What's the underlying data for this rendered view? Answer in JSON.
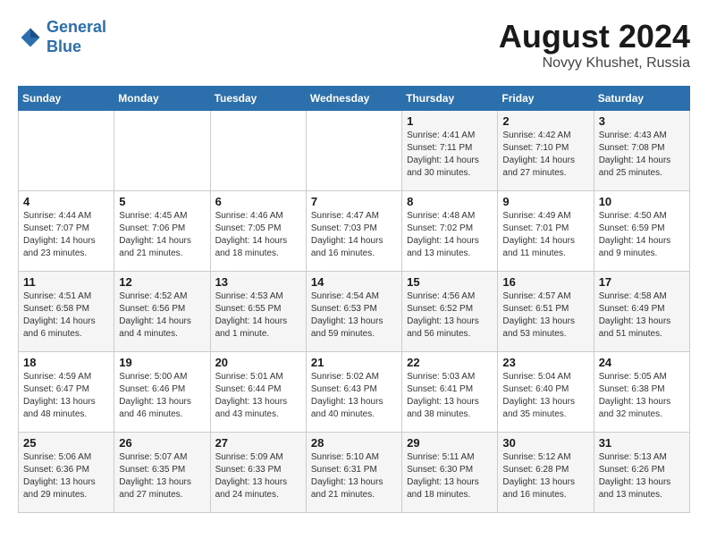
{
  "header": {
    "logo_line1": "General",
    "logo_line2": "Blue",
    "month_year": "August 2024",
    "location": "Novyy Khushet, Russia"
  },
  "weekdays": [
    "Sunday",
    "Monday",
    "Tuesday",
    "Wednesday",
    "Thursday",
    "Friday",
    "Saturday"
  ],
  "weeks": [
    [
      {
        "day": "",
        "info": ""
      },
      {
        "day": "",
        "info": ""
      },
      {
        "day": "",
        "info": ""
      },
      {
        "day": "",
        "info": ""
      },
      {
        "day": "1",
        "info": "Sunrise: 4:41 AM\nSunset: 7:11 PM\nDaylight: 14 hours\nand 30 minutes."
      },
      {
        "day": "2",
        "info": "Sunrise: 4:42 AM\nSunset: 7:10 PM\nDaylight: 14 hours\nand 27 minutes."
      },
      {
        "day": "3",
        "info": "Sunrise: 4:43 AM\nSunset: 7:08 PM\nDaylight: 14 hours\nand 25 minutes."
      }
    ],
    [
      {
        "day": "4",
        "info": "Sunrise: 4:44 AM\nSunset: 7:07 PM\nDaylight: 14 hours\nand 23 minutes."
      },
      {
        "day": "5",
        "info": "Sunrise: 4:45 AM\nSunset: 7:06 PM\nDaylight: 14 hours\nand 21 minutes."
      },
      {
        "day": "6",
        "info": "Sunrise: 4:46 AM\nSunset: 7:05 PM\nDaylight: 14 hours\nand 18 minutes."
      },
      {
        "day": "7",
        "info": "Sunrise: 4:47 AM\nSunset: 7:03 PM\nDaylight: 14 hours\nand 16 minutes."
      },
      {
        "day": "8",
        "info": "Sunrise: 4:48 AM\nSunset: 7:02 PM\nDaylight: 14 hours\nand 13 minutes."
      },
      {
        "day": "9",
        "info": "Sunrise: 4:49 AM\nSunset: 7:01 PM\nDaylight: 14 hours\nand 11 minutes."
      },
      {
        "day": "10",
        "info": "Sunrise: 4:50 AM\nSunset: 6:59 PM\nDaylight: 14 hours\nand 9 minutes."
      }
    ],
    [
      {
        "day": "11",
        "info": "Sunrise: 4:51 AM\nSunset: 6:58 PM\nDaylight: 14 hours\nand 6 minutes."
      },
      {
        "day": "12",
        "info": "Sunrise: 4:52 AM\nSunset: 6:56 PM\nDaylight: 14 hours\nand 4 minutes."
      },
      {
        "day": "13",
        "info": "Sunrise: 4:53 AM\nSunset: 6:55 PM\nDaylight: 14 hours\nand 1 minute."
      },
      {
        "day": "14",
        "info": "Sunrise: 4:54 AM\nSunset: 6:53 PM\nDaylight: 13 hours\nand 59 minutes."
      },
      {
        "day": "15",
        "info": "Sunrise: 4:56 AM\nSunset: 6:52 PM\nDaylight: 13 hours\nand 56 minutes."
      },
      {
        "day": "16",
        "info": "Sunrise: 4:57 AM\nSunset: 6:51 PM\nDaylight: 13 hours\nand 53 minutes."
      },
      {
        "day": "17",
        "info": "Sunrise: 4:58 AM\nSunset: 6:49 PM\nDaylight: 13 hours\nand 51 minutes."
      }
    ],
    [
      {
        "day": "18",
        "info": "Sunrise: 4:59 AM\nSunset: 6:47 PM\nDaylight: 13 hours\nand 48 minutes."
      },
      {
        "day": "19",
        "info": "Sunrise: 5:00 AM\nSunset: 6:46 PM\nDaylight: 13 hours\nand 46 minutes."
      },
      {
        "day": "20",
        "info": "Sunrise: 5:01 AM\nSunset: 6:44 PM\nDaylight: 13 hours\nand 43 minutes."
      },
      {
        "day": "21",
        "info": "Sunrise: 5:02 AM\nSunset: 6:43 PM\nDaylight: 13 hours\nand 40 minutes."
      },
      {
        "day": "22",
        "info": "Sunrise: 5:03 AM\nSunset: 6:41 PM\nDaylight: 13 hours\nand 38 minutes."
      },
      {
        "day": "23",
        "info": "Sunrise: 5:04 AM\nSunset: 6:40 PM\nDaylight: 13 hours\nand 35 minutes."
      },
      {
        "day": "24",
        "info": "Sunrise: 5:05 AM\nSunset: 6:38 PM\nDaylight: 13 hours\nand 32 minutes."
      }
    ],
    [
      {
        "day": "25",
        "info": "Sunrise: 5:06 AM\nSunset: 6:36 PM\nDaylight: 13 hours\nand 29 minutes."
      },
      {
        "day": "26",
        "info": "Sunrise: 5:07 AM\nSunset: 6:35 PM\nDaylight: 13 hours\nand 27 minutes."
      },
      {
        "day": "27",
        "info": "Sunrise: 5:09 AM\nSunset: 6:33 PM\nDaylight: 13 hours\nand 24 minutes."
      },
      {
        "day": "28",
        "info": "Sunrise: 5:10 AM\nSunset: 6:31 PM\nDaylight: 13 hours\nand 21 minutes."
      },
      {
        "day": "29",
        "info": "Sunrise: 5:11 AM\nSunset: 6:30 PM\nDaylight: 13 hours\nand 18 minutes."
      },
      {
        "day": "30",
        "info": "Sunrise: 5:12 AM\nSunset: 6:28 PM\nDaylight: 13 hours\nand 16 minutes."
      },
      {
        "day": "31",
        "info": "Sunrise: 5:13 AM\nSunset: 6:26 PM\nDaylight: 13 hours\nand 13 minutes."
      }
    ]
  ]
}
